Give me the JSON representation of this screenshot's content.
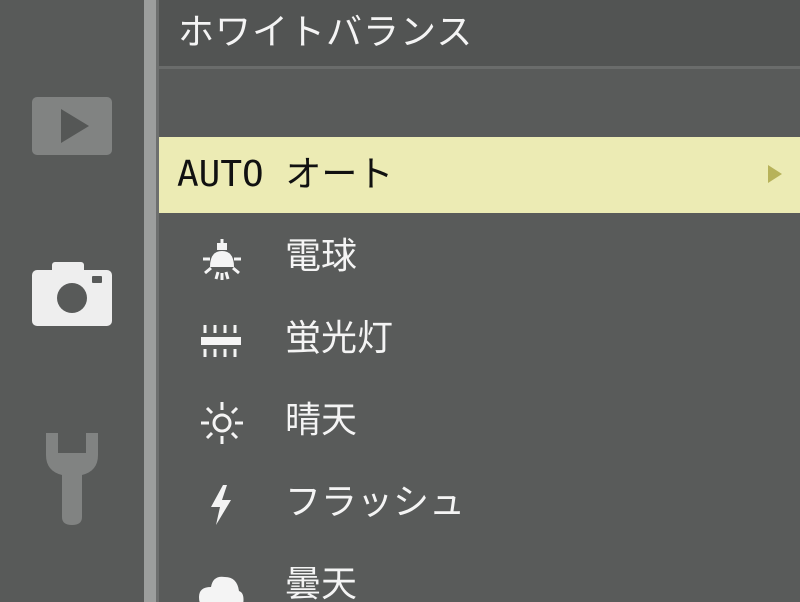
{
  "header": {
    "title": "ホワイトバランス"
  },
  "sidebar": {
    "items": [
      {
        "icon": "play-icon"
      },
      {
        "icon": "camera-icon"
      },
      {
        "icon": "wrench-icon"
      }
    ]
  },
  "menu": {
    "selected_index": 0,
    "items": [
      {
        "label": "AUTO オート",
        "icon": "none"
      },
      {
        "label": "電球",
        "icon": "bulb-icon"
      },
      {
        "label": "蛍光灯",
        "icon": "fluorescent-icon"
      },
      {
        "label": "晴天",
        "icon": "sun-icon"
      },
      {
        "label": "フラッシュ",
        "icon": "flash-icon"
      },
      {
        "label": "曇天",
        "icon": "cloud-icon"
      }
    ]
  },
  "colors": {
    "selected_row": "#ecebb4",
    "selected_arrow": "#b7b25a",
    "background": "#595b5a",
    "text": "#f4f4f4"
  }
}
